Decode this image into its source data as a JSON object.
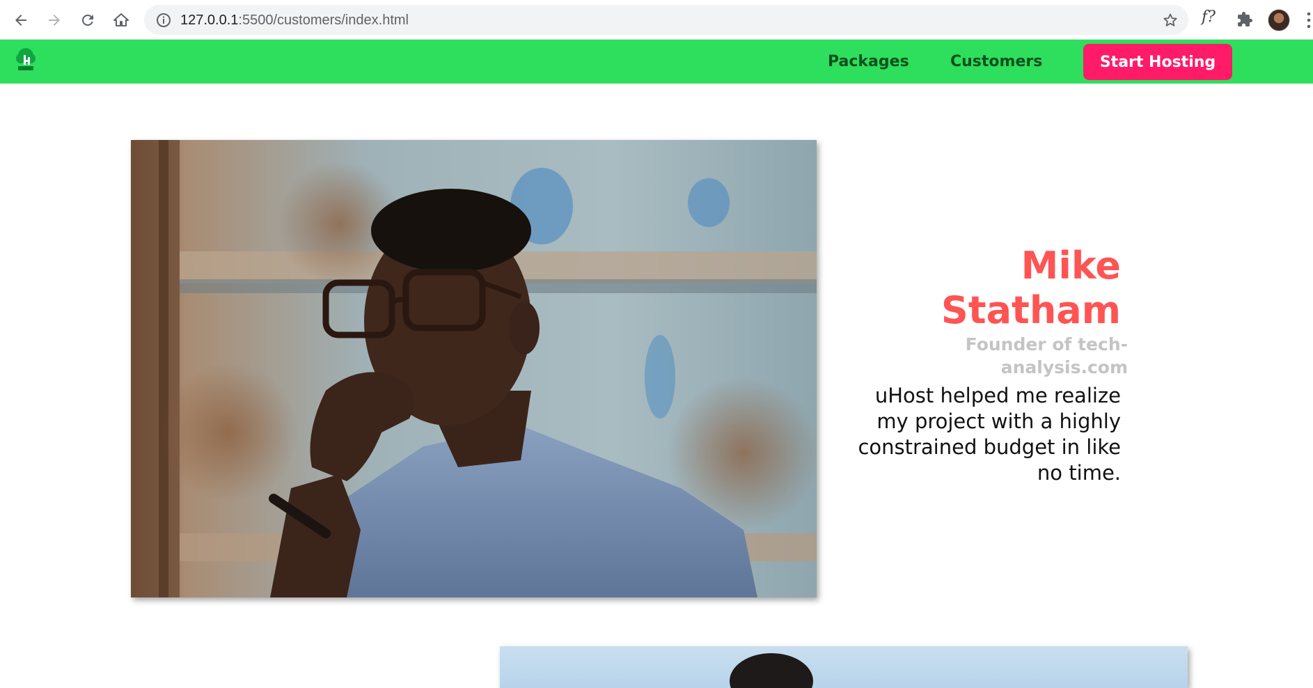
{
  "browser": {
    "url_host": "127.0.0.1",
    "url_rest": ":5500/customers/index.html",
    "extension_label": "f?"
  },
  "header": {
    "nav": {
      "packages_label": "Packages",
      "customers_label": "Customers",
      "cta_label": "Start Hosting"
    },
    "colors": {
      "background": "#2ddf5c",
      "nav_text": "#0e4f1f",
      "cta_background": "#ff1b68"
    }
  },
  "testimonial": {
    "name_line1": "Mike",
    "name_line2": "Statham",
    "role_line1": "Founder of tech-",
    "role_line2": "analysis.com",
    "quote_lines": [
      "uHost helped me realize",
      "my project with a highly",
      "constrained budget in like",
      "no time."
    ],
    "colors": {
      "name": "#ff5454",
      "role": "#c4c4c4",
      "quote": "#111111"
    }
  }
}
